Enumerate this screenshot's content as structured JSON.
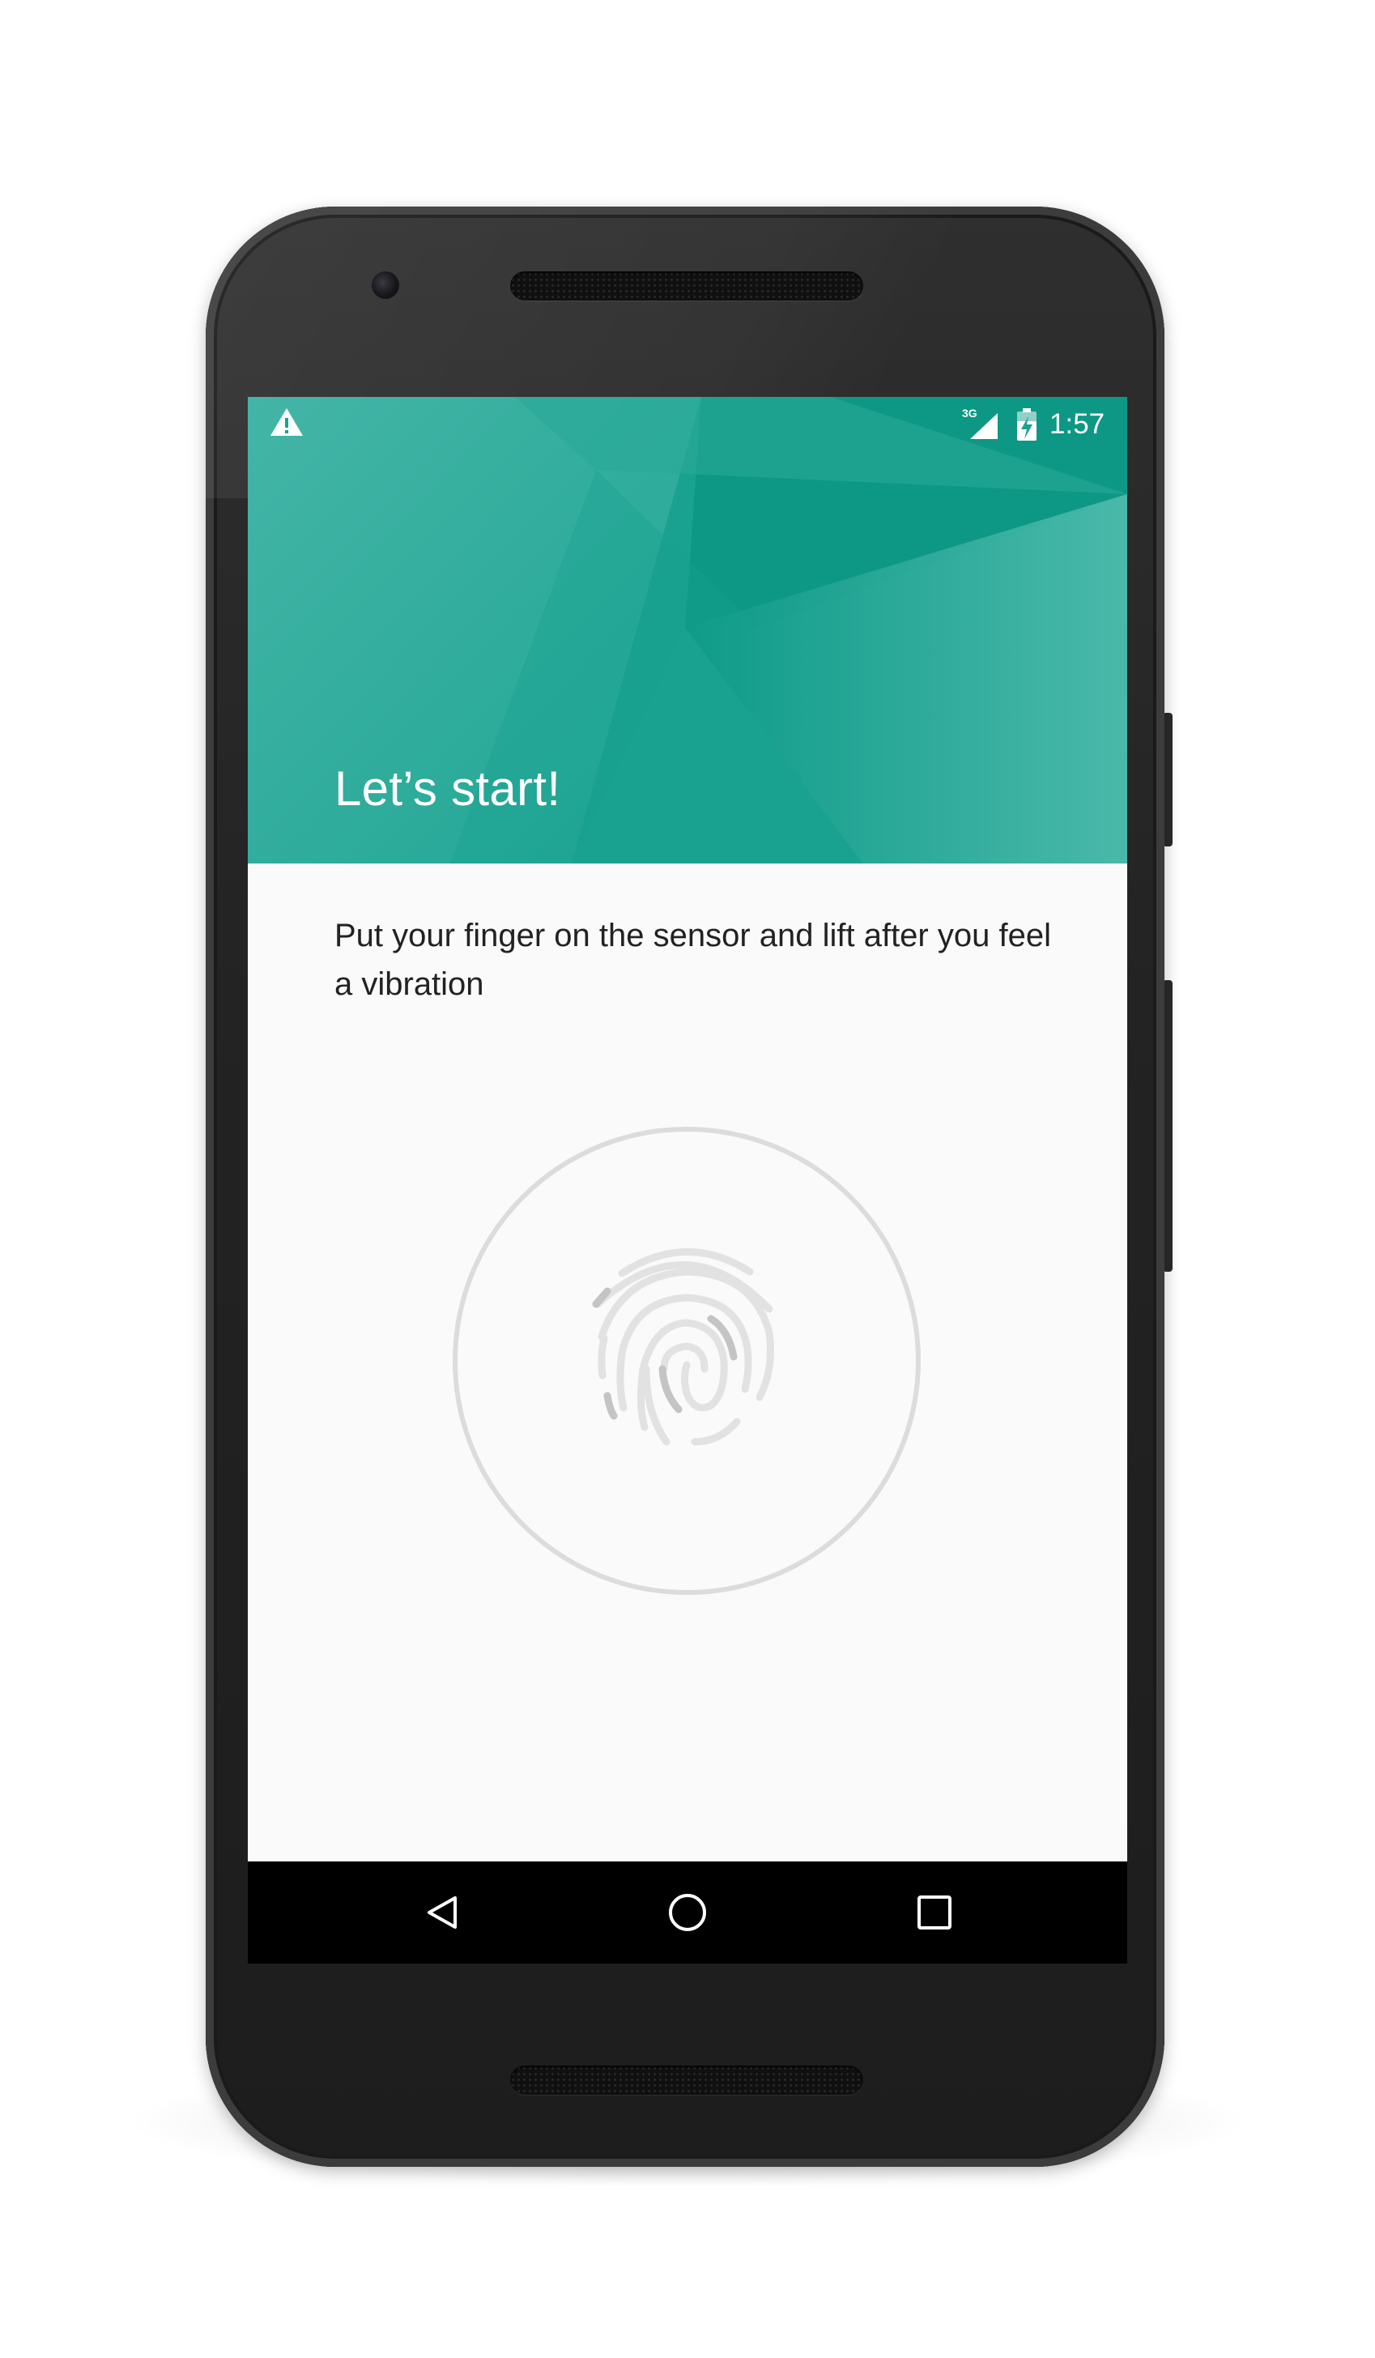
{
  "status_bar": {
    "icons": [
      "warning-icon",
      "signal-3g-icon",
      "battery-charging-icon"
    ],
    "network_label": "3G",
    "time": "1:57"
  },
  "header": {
    "title": "Let’s start!",
    "color": "#16a08f"
  },
  "body": {
    "instruction": "Put your finger on the sensor and lift after you feel a vibration"
  },
  "sensor": {
    "icon": "fingerprint-icon",
    "ring_color": "#dddddd"
  },
  "navigation_bar": {
    "buttons": [
      "back-button",
      "home-button",
      "recents-button"
    ]
  }
}
